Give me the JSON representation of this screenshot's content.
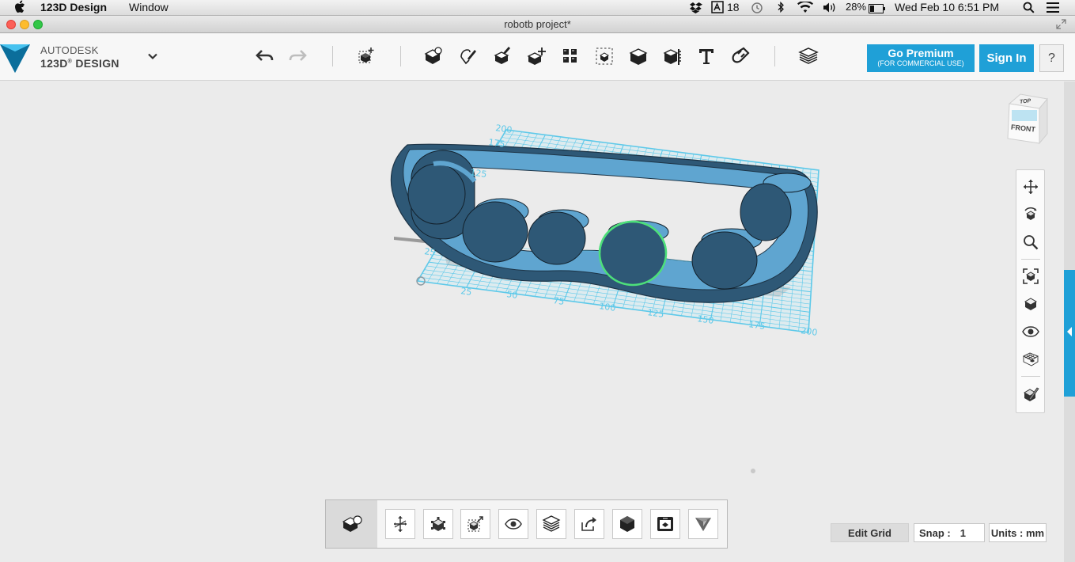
{
  "menubar": {
    "app_name": "123D Design",
    "window_menu": "Window",
    "dropbox_badge": "18",
    "battery": "28%",
    "datetime": "Wed Feb 10  6:51 PM"
  },
  "window": {
    "title": "robotb project*"
  },
  "brand": {
    "line1": "AUTODESK",
    "line2": "123D",
    "line3": "DESIGN",
    "reg": "®"
  },
  "toolbar": {
    "premium_label": "Go Premium",
    "premium_sub": "(FOR COMMERCIAL USE)",
    "signin_label": "Sign In",
    "help_label": "?"
  },
  "viewcube": {
    "top": "TOP",
    "front": "FRONT"
  },
  "grid": {
    "labels_x": [
      "25",
      "50",
      "75",
      "100",
      "125",
      "150",
      "175",
      "200"
    ],
    "labels_y": [
      "200",
      "175",
      "125",
      "25"
    ]
  },
  "status": {
    "edit_grid": "Edit Grid",
    "snap_label": "Snap :",
    "snap_value": "1",
    "units_label": "Units : mm"
  },
  "colors": {
    "accent": "#1fa0d7",
    "model_dark": "#2e5876",
    "model_top": "#5fa5d0",
    "grid_line": "#5ec9e9",
    "selection": "#4ddf7a"
  }
}
